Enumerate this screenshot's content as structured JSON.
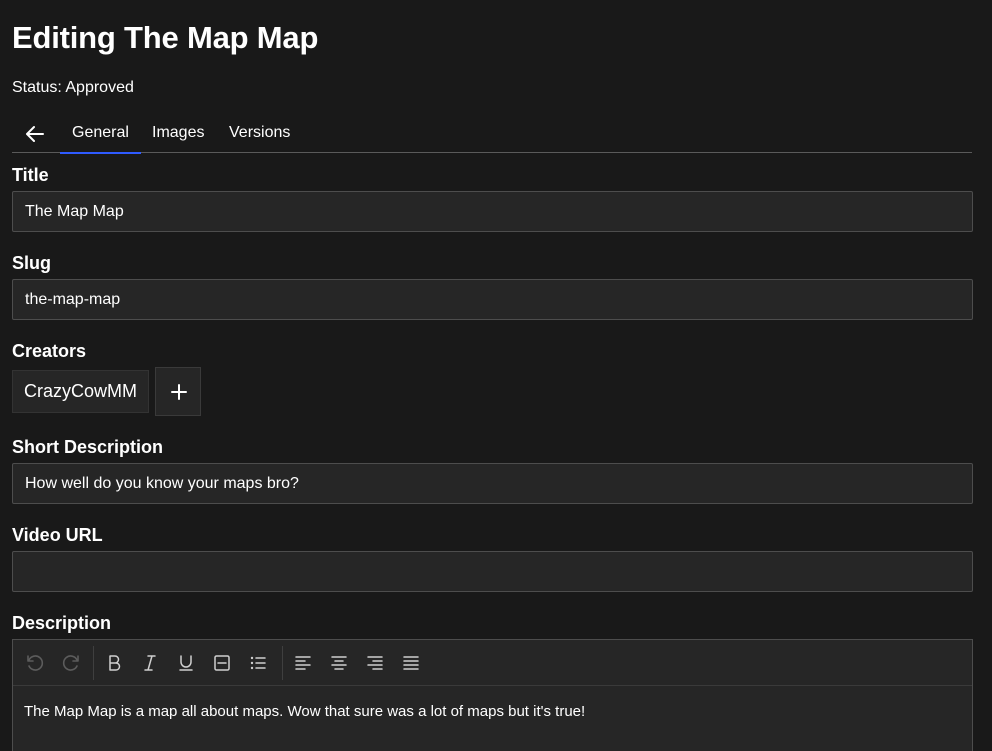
{
  "header": {
    "title": "Editing The Map Map",
    "status": "Status: Approved"
  },
  "tabs": [
    {
      "label": "General",
      "active": true
    },
    {
      "label": "Images",
      "active": false
    },
    {
      "label": "Versions",
      "active": false
    }
  ],
  "fields": {
    "title": {
      "label": "Title",
      "value": "The Map Map"
    },
    "slug": {
      "label": "Slug",
      "value": "the-map-map"
    },
    "creators": {
      "label": "Creators",
      "items": [
        "CrazyCowMM"
      ]
    },
    "short_description": {
      "label": "Short Description",
      "value": "How well do you know your maps bro?"
    },
    "video_url": {
      "label": "Video URL",
      "value": ""
    },
    "description": {
      "label": "Description",
      "content": "The Map Map is a map all about maps. Wow that sure was a lot of maps but it's true!"
    }
  },
  "toolbar_icons": [
    "undo-icon",
    "redo-icon",
    "bold-icon",
    "italic-icon",
    "underline-icon",
    "horizontal-rule-icon",
    "bullet-list-icon",
    "align-left-icon",
    "align-center-icon",
    "align-right-icon",
    "align-justify-icon"
  ],
  "colors": {
    "background": "#191919",
    "input_background": "#262626",
    "accent": "#2f5bff"
  }
}
